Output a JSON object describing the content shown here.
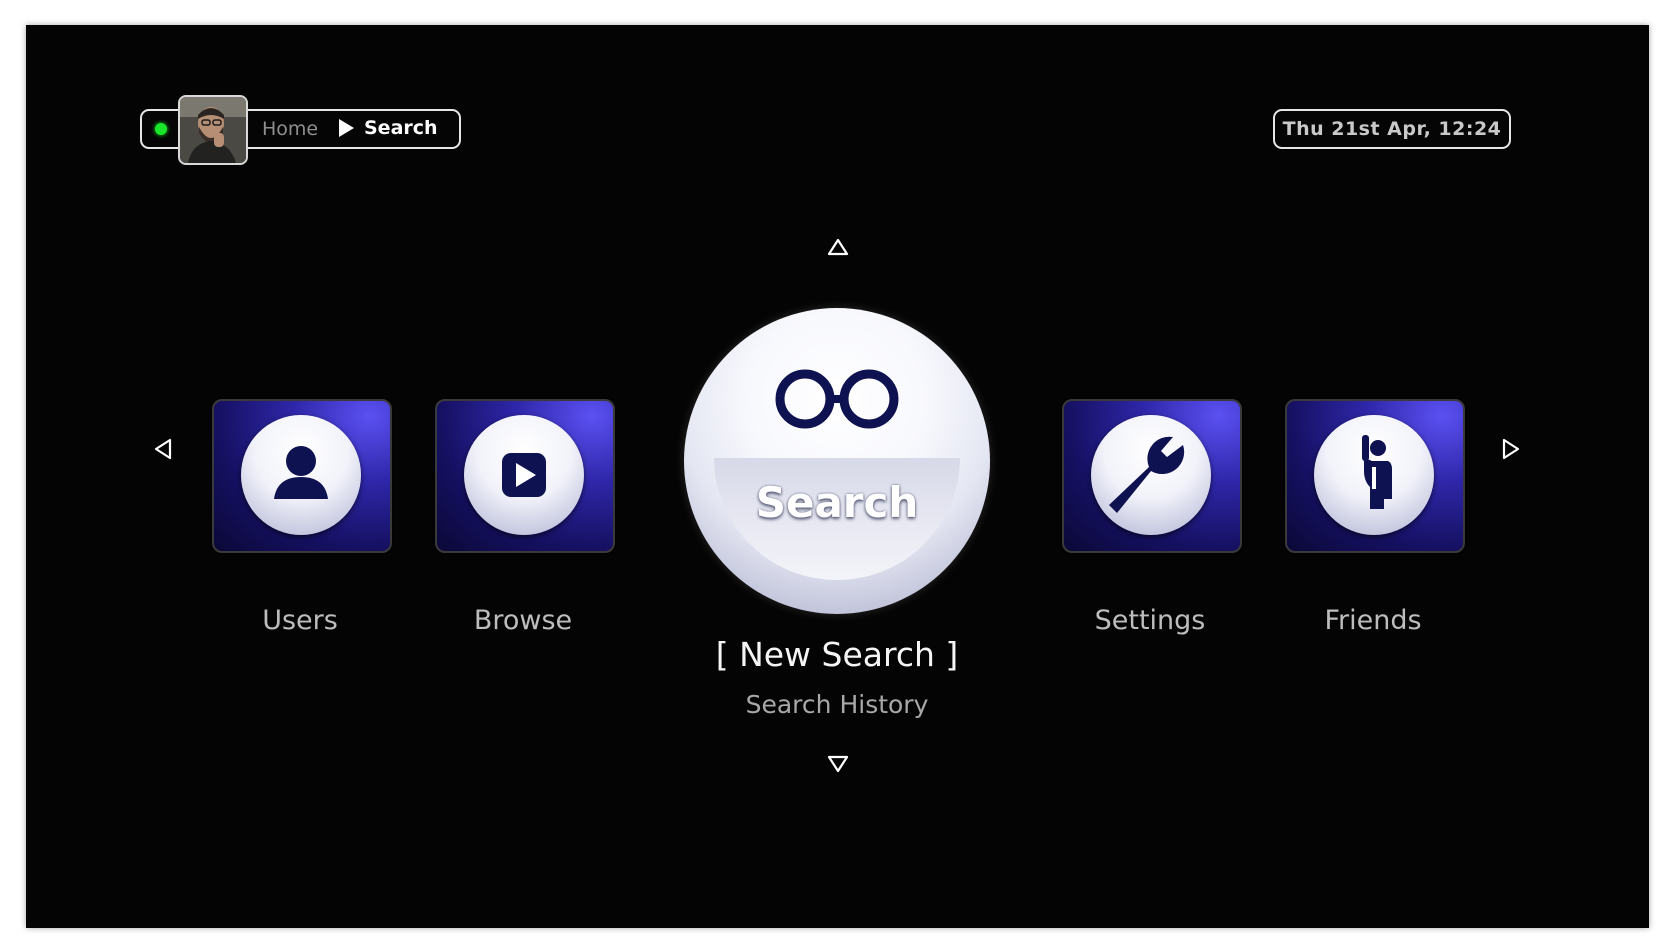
{
  "breadcrumb": {
    "home": "Home",
    "current": "Search"
  },
  "clock": "Thu 21st Apr, 12:24",
  "status": {
    "online_color": "#19e62a"
  },
  "carousel": {
    "left_items": [
      {
        "label": "Users",
        "icon": "user-icon"
      },
      {
        "label": "Browse",
        "icon": "play-icon"
      }
    ],
    "selected": {
      "label": "Search",
      "icon": "glasses-icon"
    },
    "right_items": [
      {
        "label": "Settings",
        "icon": "wrench-icon"
      },
      {
        "label": "Friends",
        "icon": "waving-person-icon"
      }
    ]
  },
  "submenu": {
    "selected": "[ New Search ]",
    "secondary": "Search History"
  },
  "colors": {
    "background": "#040404",
    "tile_accent": "#5b50f2",
    "icon_color": "#0f1250"
  }
}
